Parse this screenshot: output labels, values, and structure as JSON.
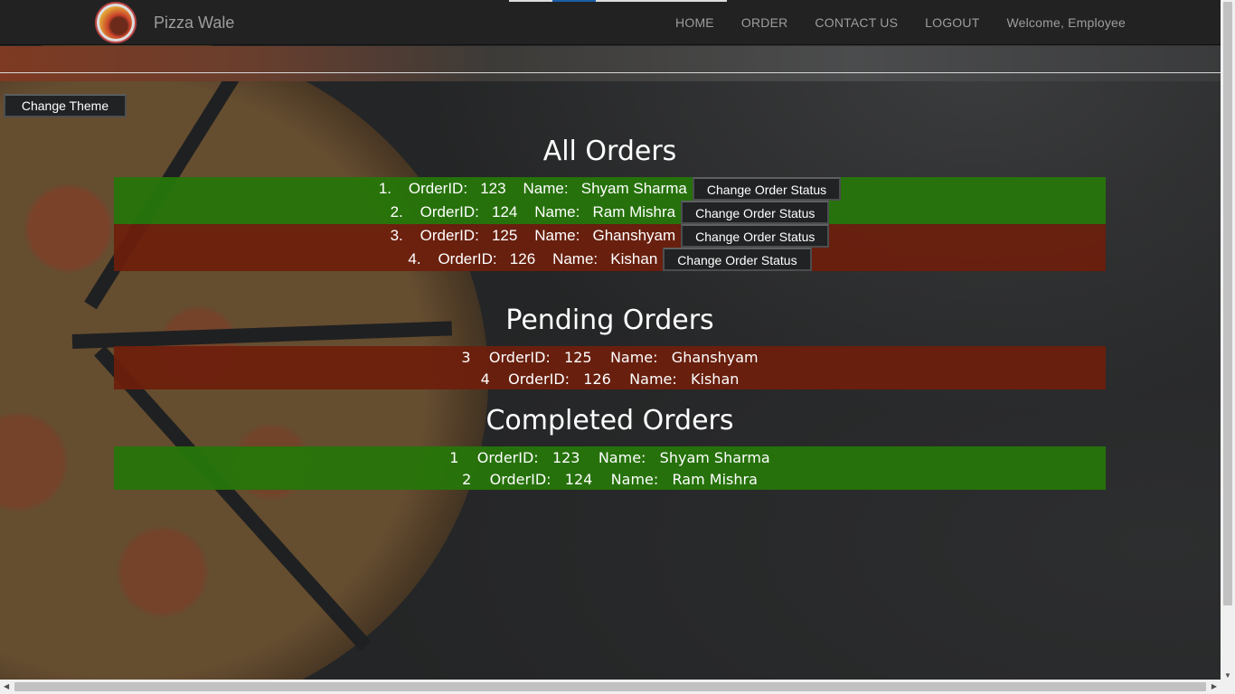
{
  "header": {
    "brand": "Pizza Wale",
    "nav": [
      {
        "label": "HOME"
      },
      {
        "label": "ORDER"
      },
      {
        "label": "CONTACT US"
      },
      {
        "label": "LOGOUT"
      },
      {
        "label": "Welcome, Employee"
      }
    ]
  },
  "theme_button": "Change Theme",
  "all_orders": {
    "title": "All Orders",
    "rows": [
      {
        "text": "1.    OrderID:   123    Name:   Shyam Sharma",
        "status": "completed"
      },
      {
        "text": "2.    OrderID:   124    Name:   Ram Mishra",
        "status": "completed"
      },
      {
        "text": "3.    OrderID:   125    Name:   Ghanshyam",
        "status": "pending"
      },
      {
        "text": "4.    OrderID:   126    Name:   Kishan",
        "status": "pending"
      }
    ],
    "button_label": "Change Order Status"
  },
  "pending_orders": {
    "title": "Pending Orders",
    "rows": [
      {
        "text": "3    OrderID:   125    Name:   Ghanshyam"
      },
      {
        "text": "4    OrderID:   126    Name:   Kishan"
      }
    ]
  },
  "completed_orders": {
    "title": "Completed Orders",
    "rows": [
      {
        "text": "1    OrderID:   123    Name:   Shyam Sharma"
      },
      {
        "text": "2    OrderID:   124    Name:   Ram Mishra"
      }
    ]
  },
  "colors": {
    "completed": "#26760a",
    "pending": "#6e1e0c"
  }
}
